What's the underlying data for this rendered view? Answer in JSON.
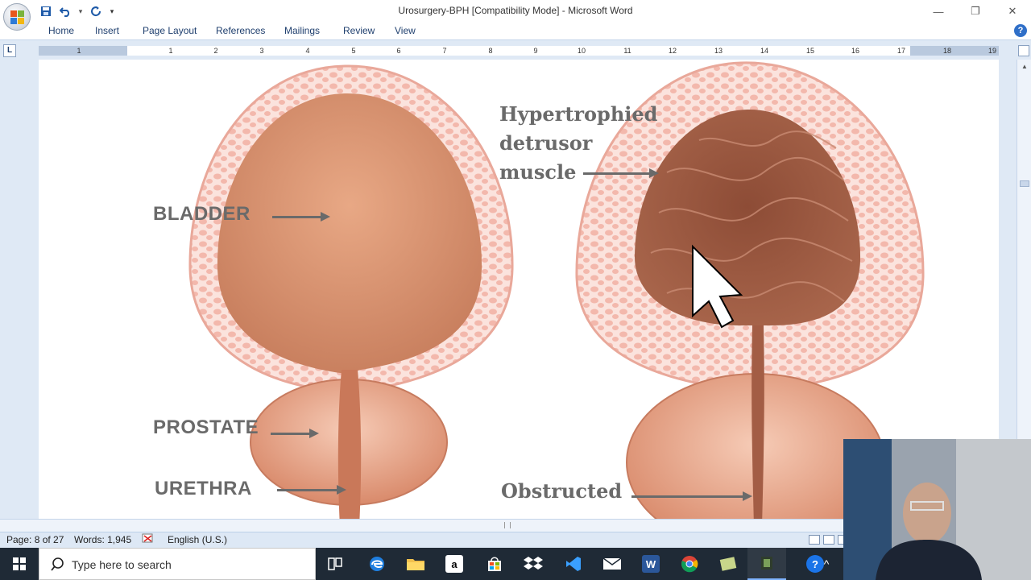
{
  "window": {
    "title": "Urosurgery-BPH [Compatibility Mode] - Microsoft Word",
    "minimize_glyph": "—",
    "restore_glyph": "❐",
    "close_glyph": "✕"
  },
  "quick_access": {
    "save_icon": "save-icon",
    "undo_icon": "undo-icon",
    "undo_dropdown": "▾",
    "redo_icon": "redo-icon",
    "customize": "▾"
  },
  "ribbon": {
    "tabs": [
      "Home",
      "Insert",
      "Page Layout",
      "References",
      "Mailings",
      "Review",
      "View"
    ],
    "help_label": "?"
  },
  "ruler": {
    "tab_selector": "L",
    "numbers": [
      "1",
      "1",
      "2",
      "3",
      "4",
      "5",
      "6",
      "7",
      "8",
      "9",
      "10",
      "11",
      "12",
      "13",
      "14",
      "15",
      "16",
      "17",
      "18",
      "19"
    ]
  },
  "illustration": {
    "left": {
      "bladder_label": "BLADDER",
      "prostate_label": "PROSTATE",
      "urethra_label": "URETHRA"
    },
    "right": {
      "hypertrophied_line1": "Hypertrophied",
      "hypertrophied_line2": "detrusor",
      "hypertrophied_line3": "muscle",
      "obstructed_label": "Obstructed"
    },
    "colors": {
      "bladder_wall": "#f7d2cc",
      "bladder_inner": "#d98c68",
      "hypertrophied_inner": "#9e5a43",
      "prostate": "#e39a7c",
      "label_gray": "#6a6a6a"
    }
  },
  "statusbar": {
    "page": "Page: 8 of 27",
    "words": "Words: 1,945",
    "language": "English (U.S.)"
  },
  "taskbar": {
    "search_placeholder": "Type here to search",
    "icons": [
      "task-view-icon",
      "edge-icon",
      "file-explorer-icon",
      "amazon-icon",
      "store-icon",
      "dropbox-icon",
      "visual-studio-icon",
      "mail-icon",
      "word-icon",
      "chrome-icon",
      "notepad-icon",
      "media-icon",
      "help-icon"
    ],
    "amazon_glyph": "a",
    "word_glyph": "W",
    "help_glyph": "?",
    "tray_chevron": "^"
  }
}
